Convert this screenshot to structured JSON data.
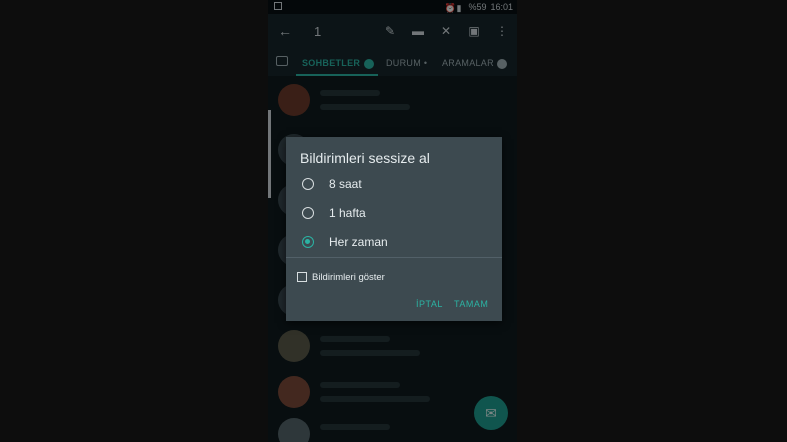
{
  "status_bar": {
    "battery": "%59",
    "time": "16:01"
  },
  "toolbar": {
    "selected_count": "1",
    "icons": [
      "back-arrow-icon",
      "pin-icon",
      "delete-icon",
      "mute-icon",
      "archive-icon",
      "more-icon"
    ]
  },
  "tabs": {
    "chats": "SOHBETLER",
    "status": "DURUM",
    "status_dot": "•",
    "calls": "ARAMALAR"
  },
  "dialog": {
    "title": "Bildirimleri sessize al",
    "options": [
      {
        "label": "8 saat",
        "selected": false
      },
      {
        "label": "1 hafta",
        "selected": false
      },
      {
        "label": "Her zaman",
        "selected": true
      }
    ],
    "show_notifications_label": "Bildirimleri göster",
    "show_notifications_checked": false,
    "cancel_label": "İPTAL",
    "ok_label": "TAMAM"
  },
  "colors": {
    "accent": "#2bb3a3",
    "dialog_bg": "#3d4a50",
    "toolbar_bg": "#16262b",
    "background": "#0f1a1e"
  }
}
